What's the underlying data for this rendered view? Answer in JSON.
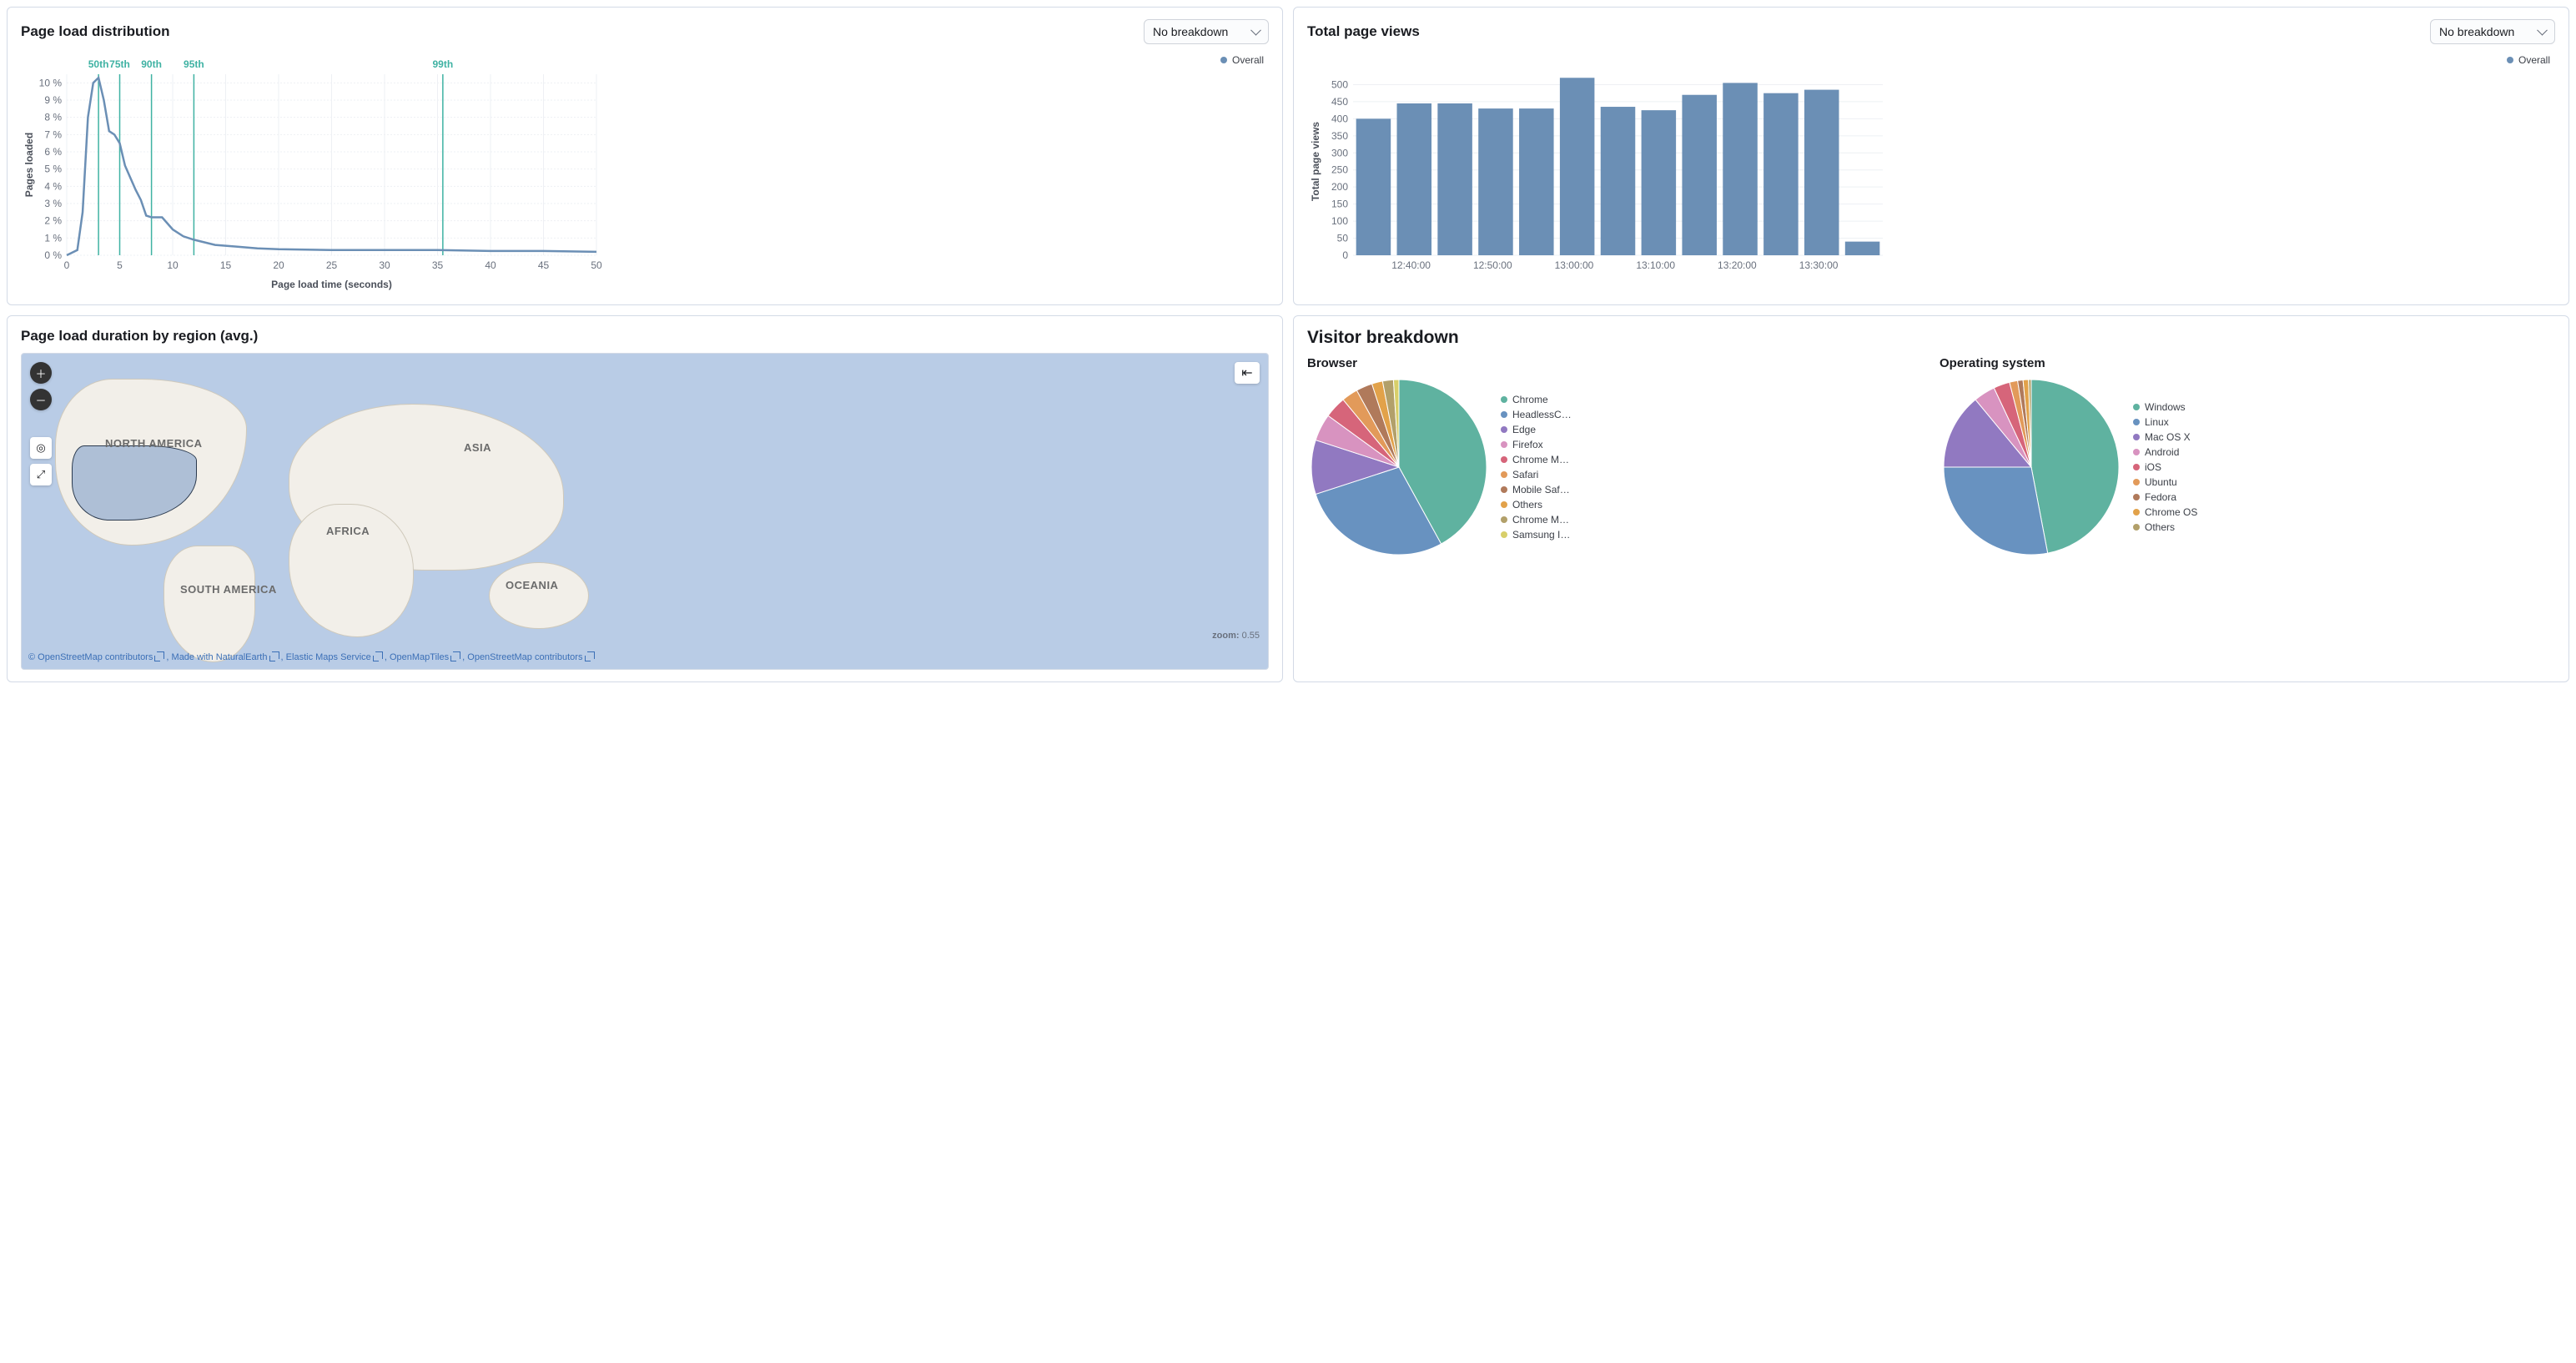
{
  "panels": {
    "pageLoadDist": {
      "title": "Page load distribution",
      "breakdown_select": "No breakdown",
      "legend": "Overall",
      "xlabel": "Page load time (seconds)",
      "ylabel": "Pages loaded"
    },
    "totalPageViews": {
      "title": "Total page views",
      "breakdown_select": "No breakdown",
      "legend": "Overall",
      "ylabel": "Total page views"
    },
    "regionMap": {
      "title": "Page load duration by region (avg.)",
      "zoom_label": "zoom:",
      "zoom_value": "0.55",
      "continents": {
        "na": "NORTH AMERICA",
        "sa": "SOUTH AMERICA",
        "af": "AFRICA",
        "as": "ASIA",
        "oc": "OCEANIA"
      },
      "attrib": {
        "osm": "© OpenStreetMap contributors",
        "ne": "Made with NaturalEarth",
        "ems": "Elastic Maps Service",
        "omt": "OpenMapTiles",
        "osm2": "OpenStreetMap contributors"
      }
    },
    "visitor": {
      "title": "Visitor breakdown",
      "browser_title": "Browser",
      "os_title": "Operating system"
    }
  },
  "chart_data": [
    {
      "id": "page_load_distribution",
      "type": "line",
      "title": "Page load distribution",
      "xlabel": "Page load time (seconds)",
      "ylabel": "Pages loaded",
      "xlim": [
        0,
        50
      ],
      "ylim": [
        0,
        10.5
      ],
      "y_unit": "%",
      "x_ticks": [
        0,
        5,
        10,
        15,
        20,
        25,
        30,
        35,
        40,
        45,
        50
      ],
      "y_ticks": [
        0,
        1,
        2,
        3,
        4,
        5,
        6,
        7,
        8,
        9,
        10
      ],
      "percentile_markers": [
        {
          "label": "50th",
          "x": 3.0
        },
        {
          "label": "75th",
          "x": 5.0
        },
        {
          "label": "90th",
          "x": 8.0
        },
        {
          "label": "95th",
          "x": 12.0
        },
        {
          "label": "99th",
          "x": 35.5
        }
      ],
      "series": [
        {
          "name": "Overall",
          "x": [
            0,
            1,
            1.5,
            2,
            2.5,
            3,
            3.5,
            4,
            4.5,
            5,
            5.5,
            6,
            6.5,
            7,
            7.5,
            8,
            9,
            10,
            11,
            12,
            14,
            16,
            18,
            20,
            25,
            30,
            35,
            40,
            45,
            50
          ],
          "y": [
            0,
            0.3,
            2.5,
            8.0,
            10.0,
            10.3,
            9.0,
            7.2,
            7.0,
            6.5,
            5.2,
            4.5,
            3.8,
            3.2,
            2.3,
            2.2,
            2.2,
            1.5,
            1.1,
            0.9,
            0.6,
            0.5,
            0.4,
            0.35,
            0.3,
            0.3,
            0.3,
            0.25,
            0.25,
            0.2
          ]
        }
      ]
    },
    {
      "id": "total_page_views",
      "type": "bar",
      "title": "Total page views",
      "ylabel": "Total page views",
      "ylim": [
        0,
        550
      ],
      "y_ticks": [
        0,
        50,
        100,
        150,
        200,
        250,
        300,
        350,
        400,
        450,
        500
      ],
      "x_tick_labels": [
        "12:40:00",
        "12:50:00",
        "13:00:00",
        "13:10:00",
        "13:20:00",
        "13:30:00"
      ],
      "series": [
        {
          "name": "Overall",
          "categories": [
            "12:35",
            "12:40",
            "12:45",
            "12:50",
            "12:55",
            "13:00",
            "13:05",
            "13:10",
            "13:15",
            "13:20",
            "13:25",
            "13:30",
            "13:35"
          ],
          "values": [
            400,
            445,
            445,
            430,
            430,
            520,
            435,
            425,
            470,
            505,
            475,
            485,
            40
          ]
        }
      ]
    },
    {
      "id": "visitor_browser",
      "type": "pie",
      "title": "Browser",
      "series": [
        {
          "name": "Chrome",
          "value": 42,
          "color": "#5fb2a0"
        },
        {
          "name": "HeadlessC…",
          "value": 28,
          "color": "#6892c0"
        },
        {
          "name": "Edge",
          "value": 10,
          "color": "#9179c1"
        },
        {
          "name": "Firefox",
          "value": 5,
          "color": "#d893c0"
        },
        {
          "name": "Chrome M…",
          "value": 4,
          "color": "#d6657a"
        },
        {
          "name": "Safari",
          "value": 3,
          "color": "#e29a5a"
        },
        {
          "name": "Mobile Saf…",
          "value": 3,
          "color": "#b07a5b"
        },
        {
          "name": "Others",
          "value": 2,
          "color": "#e2a24a"
        },
        {
          "name": "Chrome M…",
          "value": 2,
          "color": "#b2a06a"
        },
        {
          "name": "Samsung I…",
          "value": 1,
          "color": "#d8cf6a"
        }
      ]
    },
    {
      "id": "visitor_os",
      "type": "pie",
      "title": "Operating system",
      "series": [
        {
          "name": "Windows",
          "value": 47,
          "color": "#5fb2a0"
        },
        {
          "name": "Linux",
          "value": 28,
          "color": "#6892c0"
        },
        {
          "name": "Mac OS X",
          "value": 14,
          "color": "#9179c1"
        },
        {
          "name": "Android",
          "value": 4,
          "color": "#d893c0"
        },
        {
          "name": "iOS",
          "value": 3,
          "color": "#d6657a"
        },
        {
          "name": "Ubuntu",
          "value": 1.5,
          "color": "#e29a5a"
        },
        {
          "name": "Fedora",
          "value": 1,
          "color": "#b07a5b"
        },
        {
          "name": "Chrome OS",
          "value": 1,
          "color": "#e2a24a"
        },
        {
          "name": "Others",
          "value": 0.5,
          "color": "#b2a06a"
        }
      ]
    }
  ]
}
